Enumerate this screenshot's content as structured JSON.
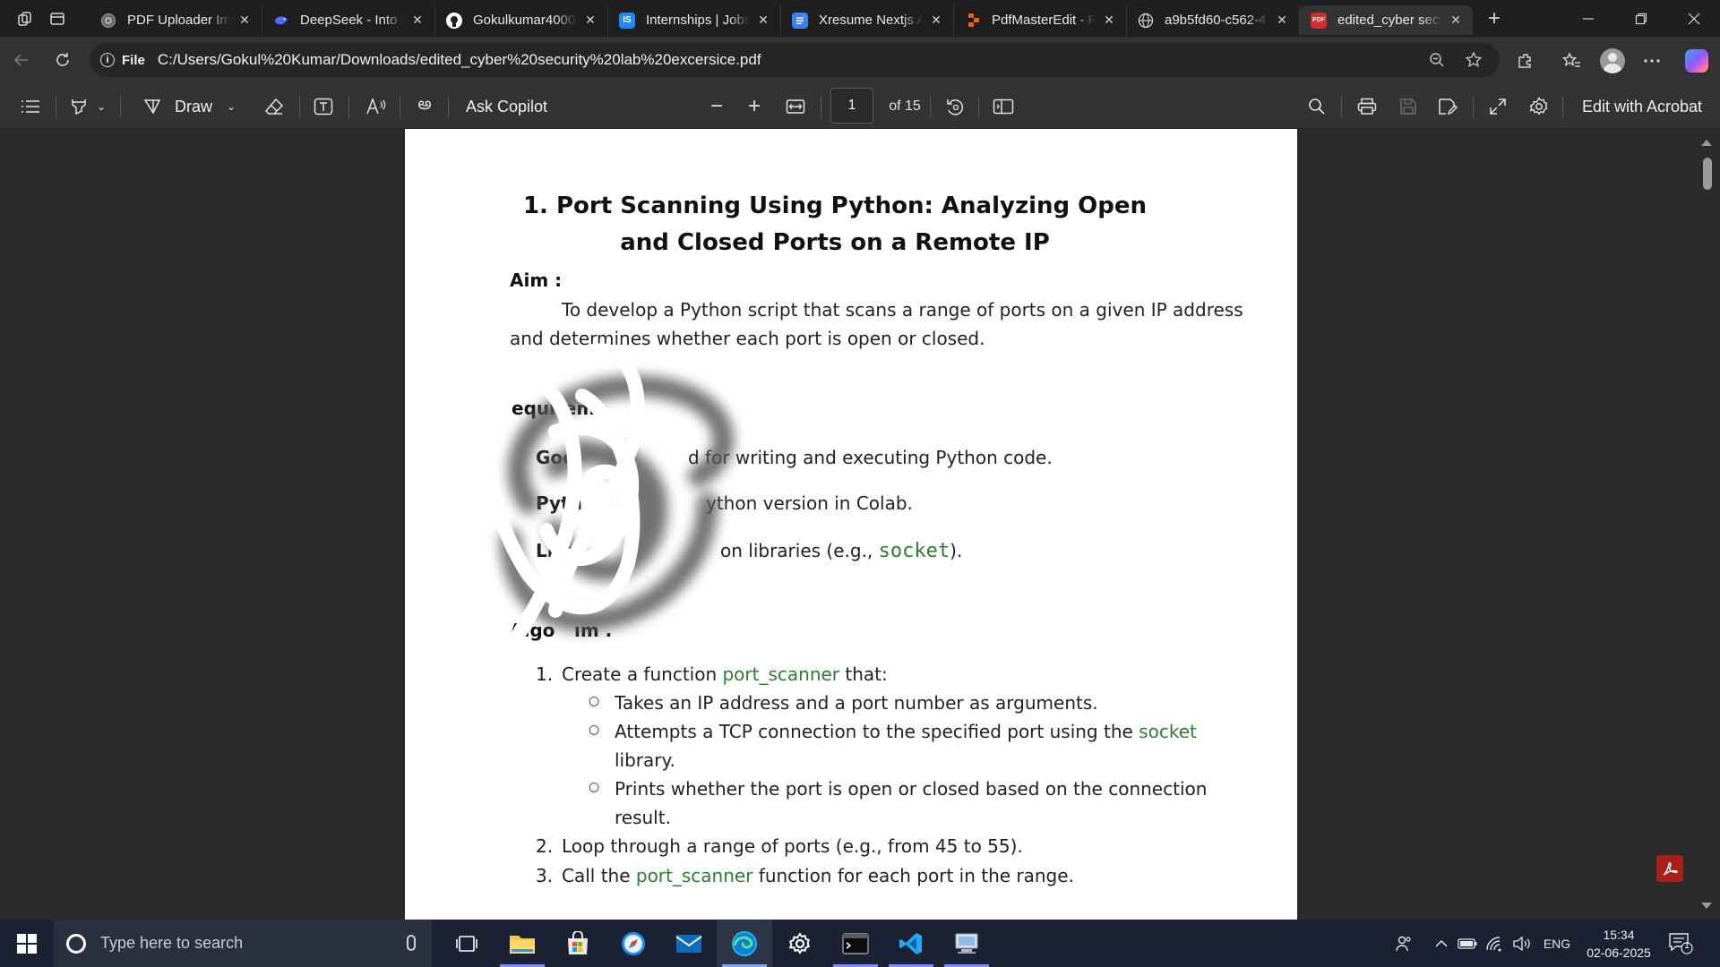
{
  "browser": {
    "tabs": [
      {
        "title": "PDF Uploader Im",
        "icon": "pdf-uploader-favicon",
        "color": "#6b6b6b"
      },
      {
        "title": "DeepSeek - Into t",
        "icon": "deepseek-whale-icon",
        "color": "#4d6bfe"
      },
      {
        "title": "Gokulkumar4000/",
        "icon": "github-icon",
        "color": "#ffffff"
      },
      {
        "title": "Internships | Jobs",
        "icon": "internshala-icon",
        "color": "#1d8cf8",
        "glyph": "IS"
      },
      {
        "title": "Xresume Nextjs A",
        "icon": "google-docs-icon",
        "color": "#3b82f6"
      },
      {
        "title": "PdfMasterEdit - R",
        "icon": "replit-icon",
        "color": "#f26207"
      },
      {
        "title": "a9b5fd60-c562-4",
        "icon": "globe-icon",
        "color": "#cfcfcf"
      },
      {
        "title": "edited_cyber secu",
        "icon": "pdf-icon",
        "color": "#d32f2f",
        "glyph": "PDF",
        "active": true
      }
    ],
    "new_tab": "+",
    "address": {
      "scheme_label": "File",
      "url": "C:/Users/Gokul%20Kumar/Downloads/edited_cyber%20security%20lab%20excersice.pdf"
    }
  },
  "pdf_toolbar": {
    "draw_label": "Draw",
    "ask_copilot_label": "Ask Copilot",
    "page_current": "1",
    "page_total": "of 15",
    "edit_label": "Edit with Acrobat",
    "zoom_out": "−",
    "zoom_in": "+"
  },
  "document": {
    "title": "1. Port Scanning Using Python: Analyzing Open and Closed Ports on a Remote IP",
    "aim_heading": "Aim :",
    "aim_line1": "To develop a Python script that scans a range of ports on a given IP address",
    "aim_line2": "and determines whether each port is open or closed.",
    "req_heading": "equireme",
    "req_colon": ":",
    "req1_start": "Goo",
    "req1_end": "d for writing and executing Python code.",
    "req2_start": "Pyth",
    "req2_end": "ython version in Colab.",
    "req3_start": "Libr",
    "req3_end_a": "on libraries (e.g., ",
    "req3_code": "socket",
    "req3_end_b": ").",
    "algo_heading_a": "Algo",
    "algo_heading_b": "ım .",
    "step1_num": "1.",
    "step1_a": "Create a function ",
    "step1_code": "port_scanner",
    "step1_b": " that:",
    "sub1": "Takes an IP address and a port number as arguments.",
    "sub2_a": "Attempts a TCP connection to the specified port using the ",
    "sub2_code": "socket",
    "sub2_b": "library.",
    "sub3_a": "Prints whether the port is open or closed based on the connection",
    "sub3_b": "result.",
    "step2_num": "2.",
    "step2": "Loop through a range of ports (e.g., from 45 to 55).",
    "step3_num": "3.",
    "step3_a": "Call the ",
    "step3_code": "port_scanner",
    "step3_b": " function for each port in the range."
  },
  "taskbar": {
    "search_placeholder": "Type here to search",
    "language": "ENG",
    "time": "15:34",
    "date": "02-06-2025",
    "notification_count": "1"
  },
  "colors": {
    "code_green": "#2e7d32",
    "tab_bg": "#1f1f1f",
    "toolbar_bg": "#333333",
    "taskbar_bg": "#1c2233"
  }
}
